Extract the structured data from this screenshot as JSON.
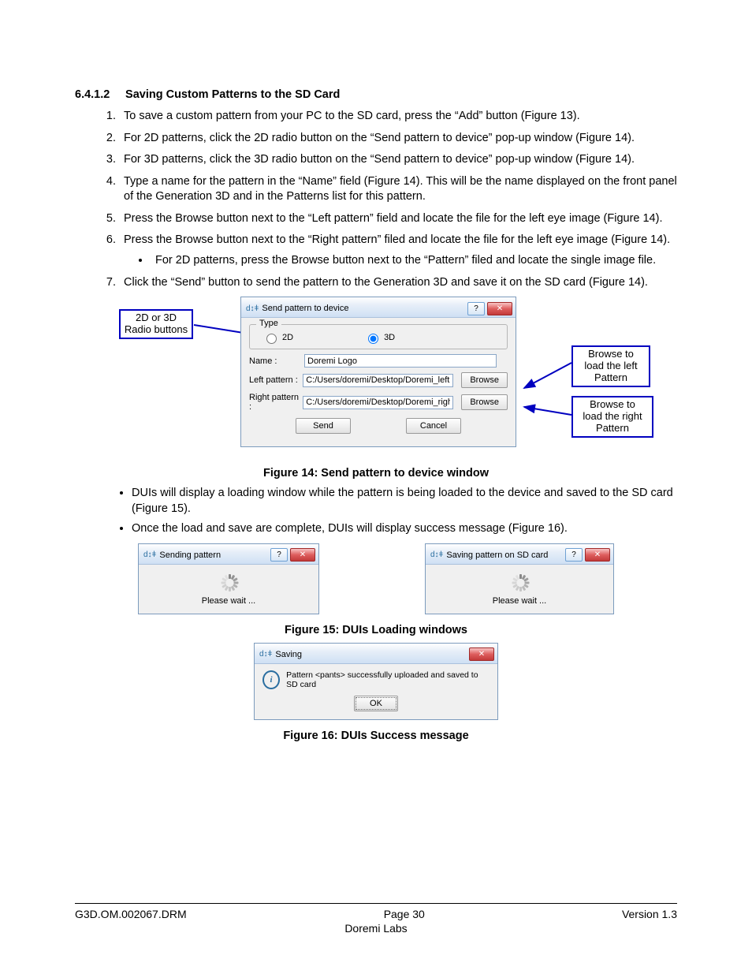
{
  "heading": {
    "num": "6.4.1.2",
    "title": "Saving Custom Patterns to the SD Card"
  },
  "steps": [
    "To save a custom pattern from your PC to the SD card, press the “Add” button (Figure 13).",
    "For 2D patterns, click the 2D radio button on the “Send pattern to device” pop-up window (Figure 14).",
    "For 3D patterns, click the 3D radio button on the “Send pattern to device” pop-up window (Figure 14).",
    "Type a name for the pattern in the “Name” field (Figure 14).  This will be the name displayed on the front panel of the Generation 3D and in the Patterns list for this pattern.",
    "Press the Browse button next to the “Left pattern” field and locate the file for the left eye image (Figure 14).",
    "Press the Browse button next to the “Right pattern” filed and locate the file for the left eye image (Figure 14)."
  ],
  "sub_bullet": "For 2D patterns, press the Browse button next to the “Pattern” filed and locate the single image file.",
  "step7": "Click the “Send” button to send the pattern to the Generation 3D and save it on the SD card (Figure 14).",
  "callouts": {
    "radio": "2D or 3D\nRadio buttons",
    "left": "Browse to\nload the left\nPattern",
    "right": "Browse to\nload the right\nPattern"
  },
  "dialog": {
    "title": "Send pattern to device",
    "type_legend": "Type",
    "r2d": "2D",
    "r3d": "3D",
    "name_lbl": "Name :",
    "name_val": "Doremi Logo",
    "left_lbl": "Left pattern :",
    "left_val": "C:/Users/doremi/Desktop/Doremi_left.ppm",
    "right_lbl": "Right pattern :",
    "right_val": "C:/Users/doremi/Desktop/Doremi_right.ppm",
    "browse": "Browse",
    "send": "Send",
    "cancel": "Cancel"
  },
  "fig14": "Figure 14: Send pattern to device window",
  "bullets": [
    "DUIs will display a loading window while the pattern is being loaded to the device and saved to the SD card (Figure 15).",
    "Once the load and save are complete, DUIs will display success message (Figure 16)."
  ],
  "loader_left": {
    "title": "Sending pattern",
    "wait": "Please wait ..."
  },
  "loader_right": {
    "title": "Saving pattern on SD card",
    "wait": "Please wait ..."
  },
  "fig15": "Figure 15: DUIs Loading windows",
  "msgbox": {
    "title": "Saving",
    "text": "Pattern <pants> successfully uploaded and saved to SD card",
    "ok": "OK"
  },
  "fig16": "Figure 16: DUIs Success message",
  "footer": {
    "left": "G3D.OM.002067.DRM",
    "center": "Page 30",
    "right": "Version 1.3",
    "sub": "Doremi Labs"
  }
}
